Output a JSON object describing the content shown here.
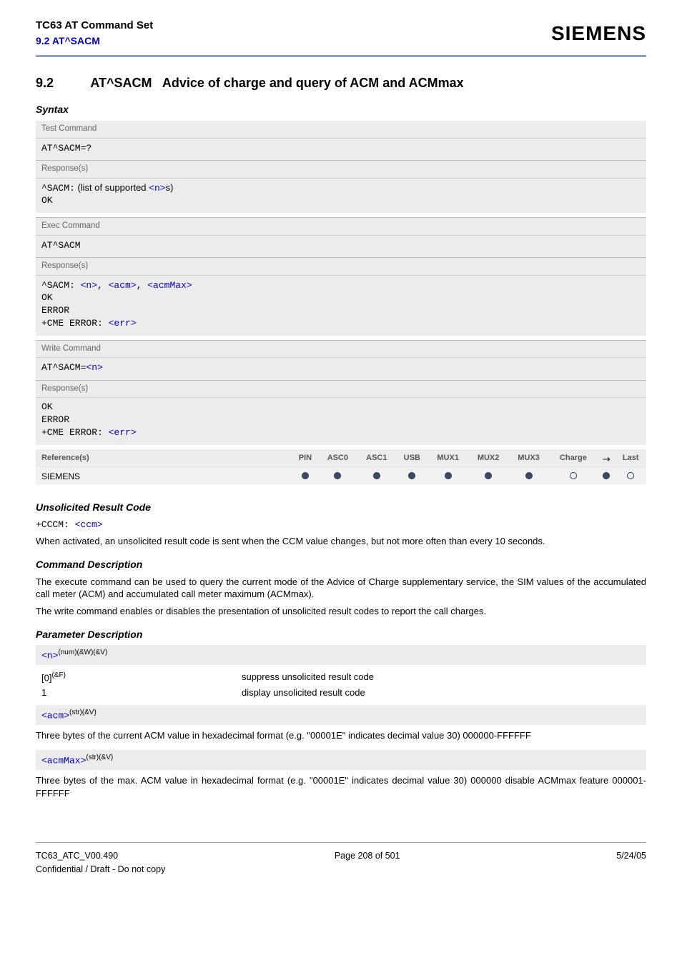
{
  "header": {
    "product": "TC63 AT Command Set",
    "section_ref": "9.2 AT^SACM",
    "brand": "SIEMENS"
  },
  "section": {
    "number": "9.2",
    "title_cmd": "AT^SACM",
    "title_desc": "Advice of charge and query of ACM and ACMmax",
    "syntax_label": "Syntax"
  },
  "syntax": {
    "test": {
      "label": "Test Command",
      "cmd": "AT^SACM=?",
      "resp_label": "Response(s)",
      "resp_prefix": "^SACM:",
      "resp_text_a": "(list of supported ",
      "resp_text_param": "<n>",
      "resp_text_b": "s)",
      "ok": "OK"
    },
    "exec": {
      "label": "Exec Command",
      "cmd": "AT^SACM",
      "resp_label": "Response(s)",
      "resp_prefix": "^SACM: ",
      "p1": "<n>",
      "c1": ", ",
      "p2": "<acm>",
      "c2": ", ",
      "p3": "<acmMax>",
      "ok": "OK",
      "error": "ERROR",
      "cme_a": "+CME ERROR: ",
      "cme_b": "<err>"
    },
    "write": {
      "label": "Write Command",
      "cmd_a": "AT^SACM=",
      "cmd_b": "<n>",
      "resp_label": "Response(s)",
      "ok": "OK",
      "error": "ERROR",
      "cme_a": "+CME ERROR: ",
      "cme_b": "<err>"
    }
  },
  "refs": {
    "label": "Reference(s)",
    "cols": [
      "PIN",
      "ASC0",
      "ASC1",
      "USB",
      "MUX1",
      "MUX2",
      "MUX3",
      "Charge",
      "➝",
      "Last"
    ],
    "source": "SIEMENS",
    "dots": [
      "f",
      "f",
      "f",
      "f",
      "f",
      "f",
      "f",
      "e",
      "f",
      "e"
    ]
  },
  "urc": {
    "heading": "Unsolicited Result Code",
    "code_a": "+CCCM: ",
    "code_b": "<ccm>",
    "para": "When activated, an unsolicited result code is sent when the CCM value changes, but not more often than every 10 seconds."
  },
  "cmddesc": {
    "heading": "Command Description",
    "p1": "The execute command can be used to query the current mode of the Advice of Charge supplementary service, the SIM values of the accumulated call meter (ACM) and accumulated call meter maximum (ACMmax).",
    "p2": "The write command enables or disables the presentation of unsolicited result codes to report the call charges."
  },
  "paramdesc": {
    "heading": "Parameter Description",
    "n": {
      "name": "<n>",
      "sup": "(num)(&W)(&V)",
      "v0_key": "[0]",
      "v0_sup": "(&F)",
      "v0_desc": "suppress unsolicited result code",
      "v1_key": "1",
      "v1_desc": "display unsolicited result code"
    },
    "acm": {
      "name": "<acm>",
      "sup": "(str)(&V)",
      "desc": "Three bytes of the current ACM value in hexadecimal format (e.g. \"00001E\" indicates decimal value 30) 000000-FFFFFF"
    },
    "acmMax": {
      "name": "<acmMax>",
      "sup": "(str)(&V)",
      "desc": "Three bytes of the max. ACM value in hexadecimal format (e.g. \"00001E\" indicates decimal value 30) 000000 disable ACMmax feature 000001-FFFFFF"
    }
  },
  "footer": {
    "doc": "TC63_ATC_V00.490",
    "page": "Page 208 of 501",
    "date": "5/24/05",
    "conf": "Confidential / Draft - Do not copy"
  }
}
